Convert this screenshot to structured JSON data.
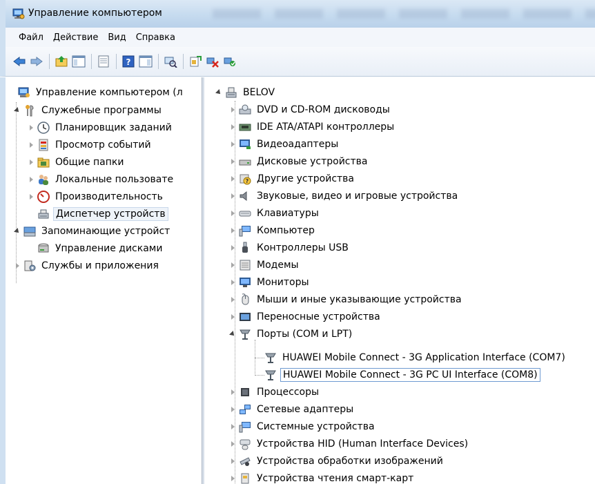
{
  "window": {
    "title": "Управление компьютером"
  },
  "menu": [
    "Файл",
    "Действие",
    "Вид",
    "Справка"
  ],
  "toolbar": {
    "icons": [
      "back-arrow-icon",
      "forward-arrow-icon",
      "up-folder-icon",
      "show-hide-tree-icon",
      "export-list-icon",
      "help-icon",
      "show-action-pane-icon",
      "scan-hardware-icon",
      "update-driver-icon",
      "uninstall-icon",
      "enable-device-icon"
    ]
  },
  "left_tree": [
    {
      "label": "Управление компьютером (л",
      "level": 0,
      "expand": "none"
    },
    {
      "label": "Служебные программы",
      "level": 1,
      "expand": "expanded"
    },
    {
      "label": "Планировщик заданий",
      "level": 2,
      "expand": "collapsed"
    },
    {
      "label": "Просмотр событий",
      "level": 2,
      "expand": "collapsed"
    },
    {
      "label": "Общие папки",
      "level": 2,
      "expand": "collapsed"
    },
    {
      "label": "Локальные пользовате",
      "level": 2,
      "expand": "collapsed"
    },
    {
      "label": "Производительность",
      "level": 2,
      "expand": "collapsed"
    },
    {
      "label": "Диспетчер устройств",
      "level": 2,
      "expand": "none",
      "selected": true
    },
    {
      "label": "Запоминающие устройст",
      "level": 1,
      "expand": "expanded"
    },
    {
      "label": "Управление дисками",
      "level": 2,
      "expand": "none"
    },
    {
      "label": "Службы и приложения",
      "level": 1,
      "expand": "collapsed"
    }
  ],
  "device_tree": {
    "root": "BELOV",
    "categories": [
      "DVD и CD-ROM дисководы",
      "IDE ATA/ATAPI контроллеры",
      "Видеоадаптеры",
      "Дисковые устройства",
      "Другие устройства",
      "Звуковые, видео и игровые устройства",
      "Клавиатуры",
      "Компьютер",
      "Контроллеры USB",
      "Модемы",
      "Мониторы",
      "Мыши и иные указывающие устройства",
      "Переносные устройства",
      "Порты (COM и LPT)"
    ],
    "ports_children": [
      "HUAWEI Mobile Connect - 3G Application Interface (COM7)",
      "HUAWEI Mobile Connect - 3G PC UI Interface (COM8)"
    ],
    "categories_after": [
      "Процессоры",
      "Сетевые адаптеры",
      "Системные устройства",
      "Устройства HID (Human Interface Devices)",
      "Устройства обработки изображений",
      "Устройства чтения смарт-карт"
    ]
  }
}
